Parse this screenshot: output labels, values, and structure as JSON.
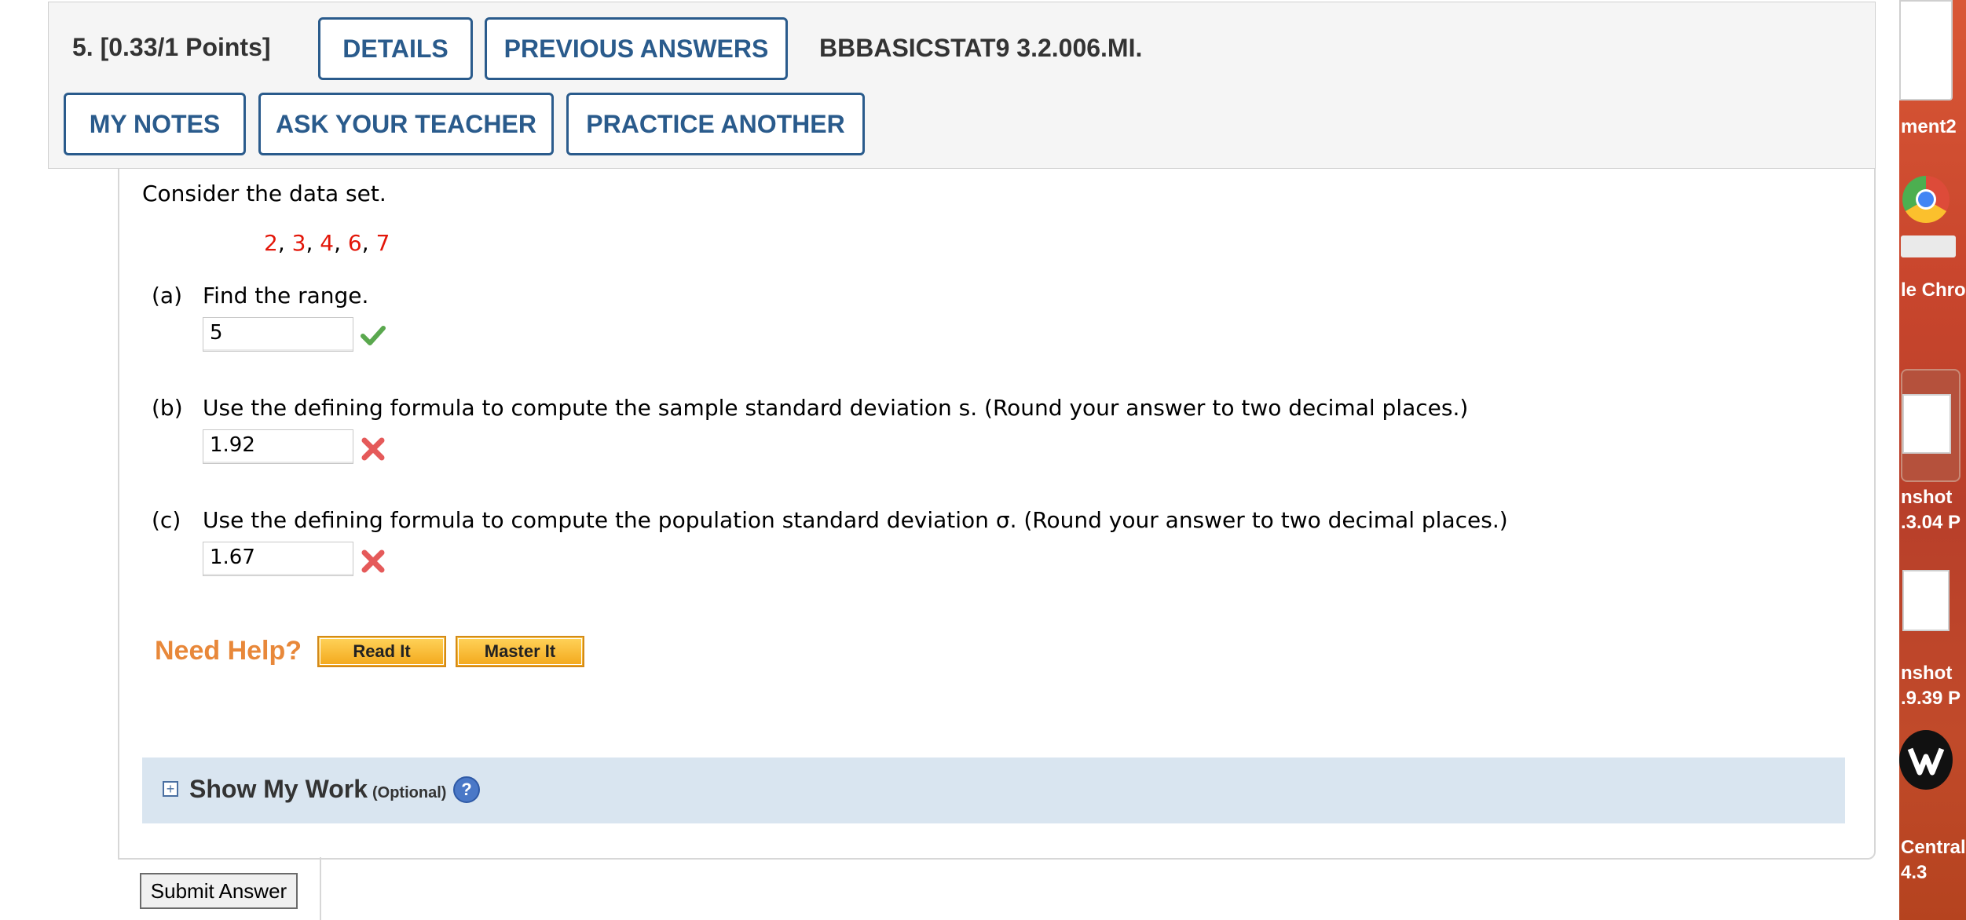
{
  "header": {
    "question_title": "5.  [0.33/1 Points]",
    "code_id": "BBBASICSTAT9 3.2.006.MI.",
    "buttons": {
      "details": "DETAILS",
      "previous_answers": "PREVIOUS ANSWERS",
      "my_notes": "MY NOTES",
      "ask_teacher": "ASK YOUR TEACHER",
      "practice_another": "PRACTICE ANOTHER"
    }
  },
  "problem": {
    "intro": "Consider the data set.",
    "dataset": [
      "2",
      "3",
      "4",
      "6",
      "7"
    ],
    "parts": [
      {
        "label": "(a)",
        "text": "Find the range.",
        "answer": "5",
        "status": "correct"
      },
      {
        "label": "(b)",
        "text": "Use the defining formula to compute the sample standard deviation s. (Round your answer to two decimal places.)",
        "answer": "1.92",
        "status": "incorrect"
      },
      {
        "label": "(c)",
        "text": "Use the defining formula to compute the population standard deviation σ. (Round your answer to two decimal places.)",
        "answer": "1.67",
        "status": "incorrect"
      }
    ]
  },
  "help": {
    "label": "Need Help?",
    "read_it": "Read It",
    "master_it": "Master It"
  },
  "show_my_work": {
    "title": "Show My Work",
    "optional": "(Optional)",
    "help_glyph": "?"
  },
  "submit_label": "Submit Answer",
  "desktop": {
    "labels": [
      "ment2",
      "le Chro",
      "nshot",
      ".3.04 P",
      "nshot",
      ".9.39 P",
      "Central",
      "4.3"
    ]
  },
  "colors": {
    "accent": "#2a5b8c",
    "dataset": "#e3170a",
    "correct": "#4caf50",
    "incorrect": "#e53935",
    "need_help": "#e8883a"
  }
}
